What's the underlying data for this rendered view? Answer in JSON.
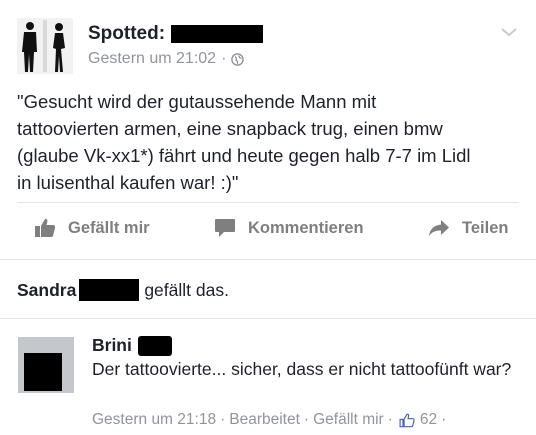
{
  "post": {
    "page_name": "Spotted:",
    "timestamp": "Gestern um 21:02",
    "privacy_separator": "·",
    "text": "\"Gesucht wird der gutaussehende Mann mit\ntattoovierten armen, eine snapback trug, einen bmw\n(glaube Vk-xx1*) fährt und heute gegen halb 7-7 im Lidl\nin luisenthal kaufen war! :)\""
  },
  "actions": {
    "like_label": "Gefällt mir",
    "comment_label": "Kommentieren",
    "share_label": "Teilen"
  },
  "likes": {
    "first_name": "Sandra",
    "suffix": "gefällt das."
  },
  "comment": {
    "author": "Brini",
    "text": "Der tattoovierte... sicher, dass er nicht tattoofünft war?",
    "timestamp": "Gestern um 21:18",
    "edited_label": "Bearbeitet",
    "like_label": "Gefällt mir",
    "like_count": "62",
    "separator": "·"
  },
  "colors": {
    "text": "#1d2129",
    "meta": "#90949c",
    "action": "#7f7f7f",
    "like_blue": "#4267b2"
  }
}
